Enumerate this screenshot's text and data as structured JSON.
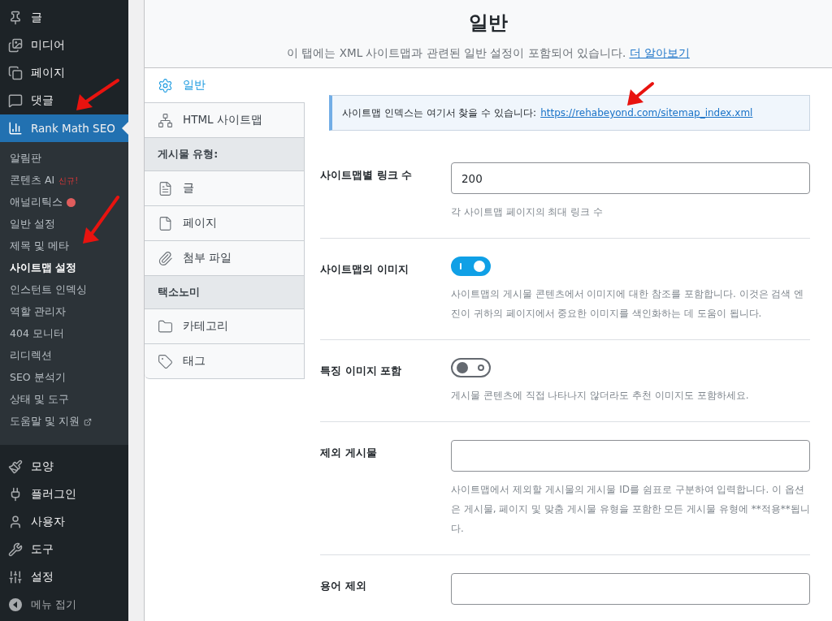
{
  "sidebar": {
    "top_items": [
      {
        "label": "글",
        "selected": false
      },
      {
        "label": "미디어",
        "selected": false
      },
      {
        "label": "페이지",
        "selected": false
      },
      {
        "label": "댓글",
        "selected": false
      },
      {
        "label": "Rank Math SEO",
        "selected": true
      }
    ],
    "submenu": [
      {
        "label": "알림판",
        "selected": false
      },
      {
        "label": "콘텐츠 AI",
        "badge": "신규!",
        "selected": false
      },
      {
        "label": "애널리틱스",
        "color": "#e05d5d",
        "selected": false
      },
      {
        "label": "일반 설정",
        "selected": false
      },
      {
        "label": "제목 및 메타",
        "selected": false
      },
      {
        "label": "사이트맵 설정",
        "selected": true
      },
      {
        "label": "인스턴트 인덱싱",
        "selected": false
      },
      {
        "label": "역할 관리자",
        "selected": false
      },
      {
        "label": "404 모니터",
        "selected": false
      },
      {
        "label": "리디렉션",
        "selected": false
      },
      {
        "label": "SEO 분석기",
        "selected": false
      },
      {
        "label": "상태 및 도구",
        "selected": false
      },
      {
        "label": "도움말 및 지원",
        "external": true,
        "selected": false
      }
    ],
    "bottom_items": [
      {
        "label": "모양",
        "kind": "menu"
      },
      {
        "label": "플러그인",
        "kind": "menu"
      },
      {
        "label": "사용자",
        "kind": "menu"
      },
      {
        "label": "도구",
        "kind": "menu"
      },
      {
        "label": "설정",
        "kind": "menu"
      },
      {
        "label": "메뉴 접기",
        "kind": "collapse"
      }
    ]
  },
  "header": {
    "title": "일반",
    "description": "이 탭에는 XML 사이트맵과 관련된 일반 설정이 포함되어 있습니다.",
    "link": "더 알아보기"
  },
  "tabs": [
    {
      "kind": "tab",
      "label": "일반",
      "selected": true
    },
    {
      "kind": "tab",
      "label": "HTML 사이트맵",
      "selected": false
    },
    {
      "kind": "heading",
      "label": "게시물 유형:"
    },
    {
      "kind": "tab",
      "label": "글",
      "selected": false
    },
    {
      "kind": "tab",
      "label": "페이지",
      "selected": false
    },
    {
      "kind": "tab",
      "label": "첨부 파일",
      "selected": false
    },
    {
      "kind": "heading",
      "label": "택소노미"
    },
    {
      "kind": "tab",
      "label": "카테고리",
      "selected": false
    },
    {
      "kind": "tab",
      "label": "태그",
      "selected": false
    }
  ],
  "notice": {
    "text": "사이트맵 인덱스는 여기서 찾을 수 있습니다:",
    "link": "https://rehabeyond.com/sitemap_index.xml"
  },
  "settings": [
    {
      "kind": "input",
      "label": "사이트맵별 링크 수",
      "value": "200",
      "description": "각 사이트맵 페이지의 최대 링크 수"
    },
    {
      "kind": "toggle",
      "label": "사이트맵의 이미지",
      "on": true,
      "description": "사이트맵의 게시물 콘텐츠에서 이미지에 대한 참조를 포함합니다. 이것은 검색 엔진이 귀하의 페이지에서 중요한 이미지를 색인화하는 데 도움이 됩니다."
    },
    {
      "kind": "toggle",
      "label": "특징 이미지 포함",
      "on": false,
      "description": "게시물 콘텐츠에 직접 나타나지 않더라도 추천 이미지도 포함하세요."
    },
    {
      "kind": "input",
      "label": "제외 게시물",
      "description": "사이트맵에서 제외할 게시물의 게시물 ID를 쉼표로 구분하여 입력합니다. 이 옵션은 게시물, 페이지 및 맞춤 게시물 유형을 포함한 모든 게시물 유형에 **적용**됩니다."
    },
    {
      "kind": "input",
      "label": "용어 제외"
    }
  ]
}
